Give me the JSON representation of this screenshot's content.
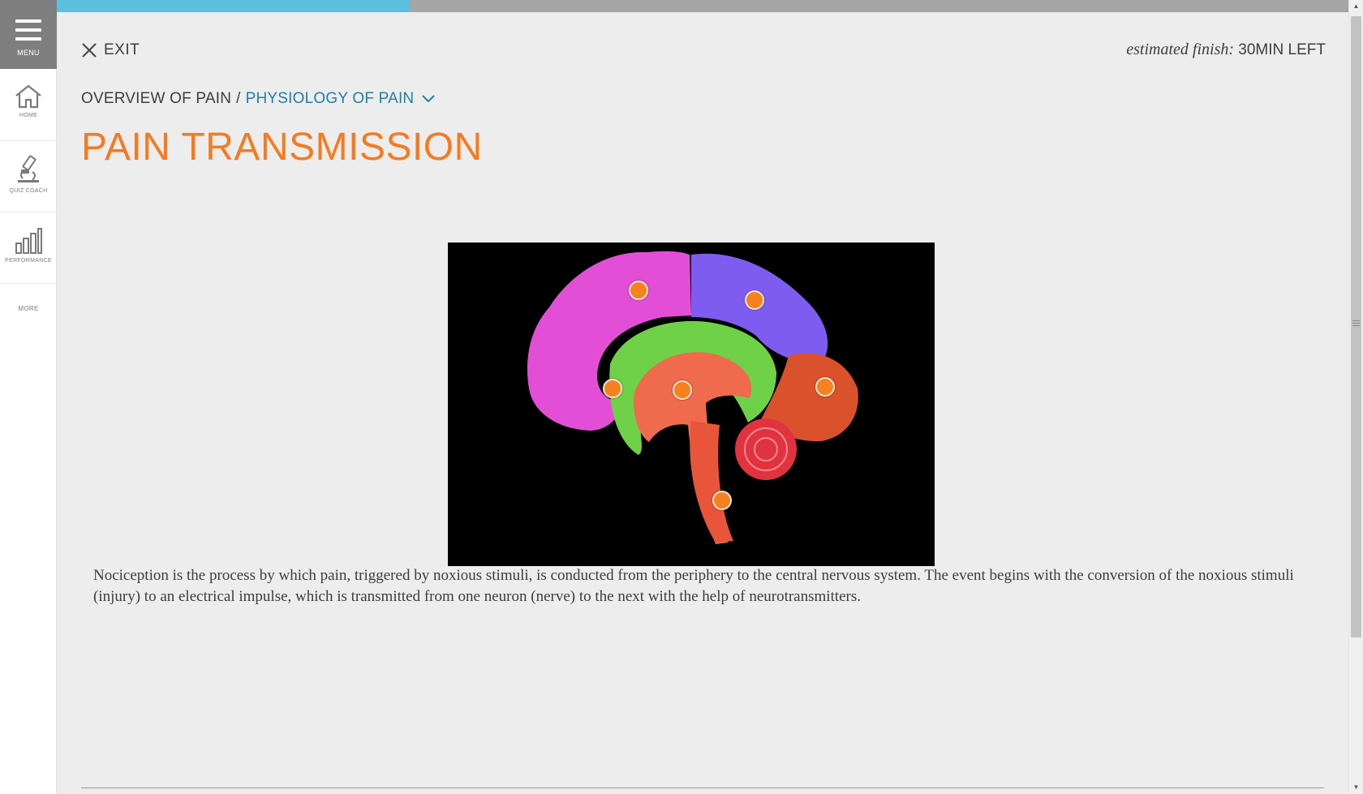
{
  "sidebar": {
    "menu_label": "MENU",
    "items": [
      {
        "id": "home",
        "label": "HOME",
        "icon": "home-icon"
      },
      {
        "id": "quiz",
        "label": "QUIZ COACH",
        "icon": "microscope-icon"
      },
      {
        "id": "perf",
        "label": "PERFORMANCE",
        "icon": "bar-chart-icon"
      },
      {
        "id": "more",
        "label": "MORE"
      }
    ]
  },
  "progress": {
    "fraction": 0.273
  },
  "header": {
    "exit_label": "EXIT",
    "finish_prefix": "estimated finish:",
    "finish_value": "30MIN LEFT"
  },
  "breadcrumb": {
    "parent": "OVERVIEW OF PAIN",
    "separator": "/",
    "current": "PHYSIOLOGY OF PAIN"
  },
  "page": {
    "title": "PAIN TRANSMISSION",
    "body": "Nociception is the process by which pain, triggered by noxious stimuli, is conducted from the periphery to the central nervous system. The event begins with the conversion of the noxious stimuli (injury) to an electrical impulse, which is transmitted from one neuron (nerve) to the next with the help of neurotransmitters."
  },
  "figure": {
    "hotspot_count": 6,
    "colors": {
      "frontal": "#e24fd6",
      "parietal": "#7f5cf0",
      "limbic": "#6fd148",
      "occipital": "#d9522b",
      "thalamus": "#f06a4e",
      "cerebellum": "#e0323f",
      "hotspot": "#f5821f"
    }
  },
  "colors": {
    "accent_title": "#f47b20",
    "link": "#1f7ea6",
    "progress": "#5bc0de"
  }
}
